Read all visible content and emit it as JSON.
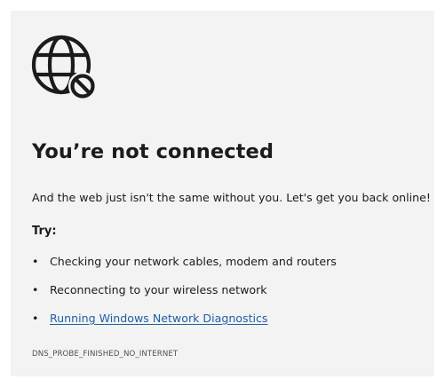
{
  "error_page": {
    "icon": "globe-no-connection-icon",
    "title": "You’re not connected",
    "message": "And the web just isn't the same without you. Let's get you back online!",
    "try_heading": "Try:",
    "suggestions": [
      {
        "text": "Checking your network cables, modem and routers",
        "link": false
      },
      {
        "text": "Reconnecting to your wireless network",
        "link": false
      },
      {
        "text": "Running Windows Network Diagnostics",
        "link": true
      }
    ],
    "bullet": "•",
    "error_code": "DNS_PROBE_FINISHED_NO_INTERNET"
  },
  "colors": {
    "background": "#f3f3f3",
    "text": "#1b1b1b",
    "link": "#1f5fa3",
    "muted": "#505050"
  }
}
